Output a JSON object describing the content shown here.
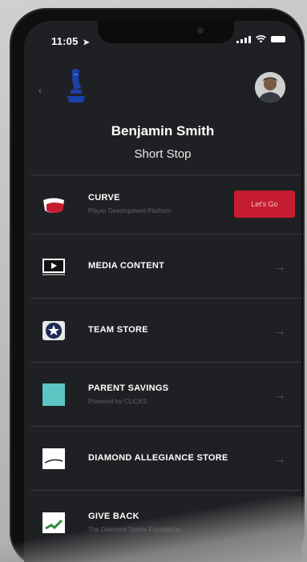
{
  "status_bar": {
    "time": "11:05"
  },
  "header": {
    "profile_name": "Benjamin Smith",
    "profile_position": "Short Stop"
  },
  "menu": [
    {
      "title": "CURVE",
      "subtitle": "Player Development Platform",
      "icon": "curve-logo-icon",
      "action_label": "Let's Go"
    },
    {
      "title": "MEDIA CONTENT",
      "icon": "video-player-icon"
    },
    {
      "title": "TEAM STORE",
      "icon": "star-badge-icon"
    },
    {
      "title": "PARENT SAVINGS",
      "subtitle": "Powered by CLICKS",
      "icon": "parent-savings-icon"
    },
    {
      "title": "DIAMOND ALLEGIANCE STORE",
      "icon": "diamond-allegiance-icon"
    },
    {
      "title": "GIVE BACK",
      "subtitle": "The Diamond Sports Foundation",
      "icon": "give-back-icon"
    }
  ],
  "colors": {
    "screen_bg": "#1f2023",
    "accent_red": "#c51d2f",
    "divider": "#3a3b40"
  }
}
